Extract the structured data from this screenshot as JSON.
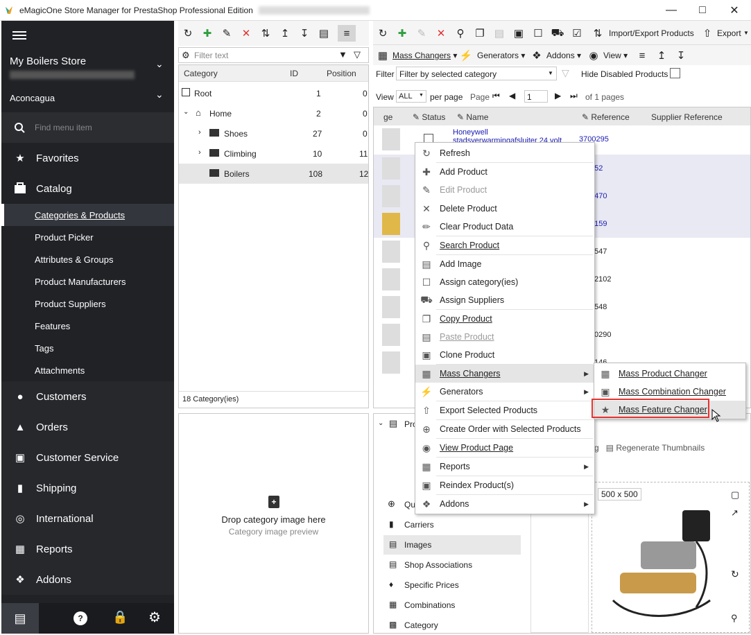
{
  "window": {
    "title": "eMagicOne Store Manager for PrestaShop Professional Edition"
  },
  "sidebar": {
    "store_name": "My Boilers Store",
    "theme": "Aconcagua",
    "search_placeholder": "Find menu item",
    "items": [
      {
        "label": "Favorites",
        "icon": "star-icon"
      },
      {
        "label": "Catalog",
        "icon": "catalog-icon"
      }
    ],
    "catalog_sub": [
      {
        "label": "Categories & Products",
        "u": "C"
      },
      {
        "label": "Product Picker"
      },
      {
        "label": "Attributes & Groups"
      },
      {
        "label": "Product Manufacturers"
      },
      {
        "label": "Product Suppliers"
      },
      {
        "label": "Features"
      },
      {
        "label": "Tags"
      },
      {
        "label": "Attachments"
      }
    ],
    "items2": [
      {
        "label": "Customers",
        "icon": "customers-icon"
      },
      {
        "label": "Orders",
        "icon": "orders-icon"
      },
      {
        "label": "Customer Service",
        "icon": "chat-icon"
      },
      {
        "label": "Shipping",
        "icon": "truck-icon"
      },
      {
        "label": "International",
        "icon": "globe-icon"
      },
      {
        "label": "Reports",
        "icon": "reports-icon"
      },
      {
        "label": "Addons",
        "icon": "puzzle-icon"
      }
    ]
  },
  "categories": {
    "filter_placeholder": "Filter text",
    "col_category": "Category",
    "col_id": "ID",
    "col_position": "Position",
    "rows": [
      {
        "name": "Root",
        "id": "1",
        "pos": "0"
      },
      {
        "name": "Home",
        "id": "2",
        "pos": "0"
      },
      {
        "name": "Shoes",
        "id": "27",
        "pos": "0"
      },
      {
        "name": "Climbing",
        "id": "10",
        "pos": "11"
      },
      {
        "name": "Boilers",
        "id": "108",
        "pos": "12"
      }
    ],
    "count": "18 Category(ies)",
    "drop_title": "Drop category image here",
    "drop_sub": "Category image preview"
  },
  "products": {
    "toolbar": {
      "import_export": "Import/Export Products",
      "export": "Export"
    },
    "toolbar2": {
      "mass": "Mass Changers",
      "generators": "Generators",
      "addons": "Addons",
      "view": "View"
    },
    "filter_label": "Filter",
    "filter_value": "Filter by selected category",
    "hide_disabled": "Hide Disabled Products",
    "view_label": "View",
    "view_value": "ALL",
    "per_page": "per page",
    "page_label": "Page",
    "page_value": "1",
    "of_pages": "of 1 pages",
    "cols": {
      "image": "ge",
      "status": "Status",
      "name": "Name",
      "reference": "Reference",
      "supplier_ref": "Supplier Reference"
    },
    "first_name": "Honeywell",
    "first_name2": "stadsverwarmingafsluiter 24 volt",
    "refs": [
      "3700295",
      "152",
      "0470",
      "0159",
      "547",
      "2102",
      "548",
      "0290",
      "146"
    ]
  },
  "bottom": {
    "regen": "Regenerate Thumbnails",
    "img_size": "500 x 500",
    "tabs": [
      "Carriers",
      "Images",
      "Shop Associations",
      "Specific Prices",
      "Combinations",
      "Category"
    ],
    "tab_partial_1": "Pro",
    "tab_partial_2": "Qu"
  },
  "context_menu": [
    {
      "label": "Refresh",
      "icon": "refresh-icon"
    },
    {
      "label": "Add Product",
      "icon": "plus-icon"
    },
    {
      "label": "Edit Product",
      "icon": "pencil-icon",
      "disabled": true
    },
    {
      "label": "Delete Product",
      "icon": "delete-icon"
    },
    {
      "label": "Clear Product Data",
      "icon": "eraser-icon"
    },
    {
      "label": "Search Product",
      "icon": "search-icon"
    },
    {
      "label": "Add Image",
      "icon": "add-image-icon"
    },
    {
      "label": "Assign category(ies)",
      "icon": "assign-category-icon"
    },
    {
      "label": "Assign Suppliers",
      "icon": "assign-suppliers-icon"
    },
    {
      "label": "Copy Product",
      "icon": "copy-icon"
    },
    {
      "label": "Paste Product",
      "icon": "paste-icon",
      "disabled": true
    },
    {
      "label": "Clone Product",
      "icon": "clone-icon"
    },
    {
      "label": "Mass Changers",
      "icon": "mass-changers-icon",
      "submenu": true
    },
    {
      "label": "Generators",
      "icon": "generators-icon",
      "submenu": true
    },
    {
      "label": "Export Selected Products",
      "icon": "export-icon"
    },
    {
      "label": "Create Order with Selected Products",
      "icon": "create-order-icon"
    },
    {
      "label": "View Product Page",
      "icon": "view-page-icon"
    },
    {
      "label": "Reports",
      "icon": "reports-icon",
      "submenu": true
    },
    {
      "label": "Reindex Product(s)",
      "icon": "reindex-icon"
    },
    {
      "label": "Addons",
      "icon": "addons-icon",
      "submenu": true
    }
  ],
  "submenu": [
    {
      "label": "Mass Product Changer"
    },
    {
      "label": "Mass Combination Changer"
    },
    {
      "label": "Mass Feature Changer"
    }
  ],
  "colors": {
    "sidebar_bg": "#202226",
    "highlight": "#e5312f",
    "link": "#1a1ab3"
  }
}
